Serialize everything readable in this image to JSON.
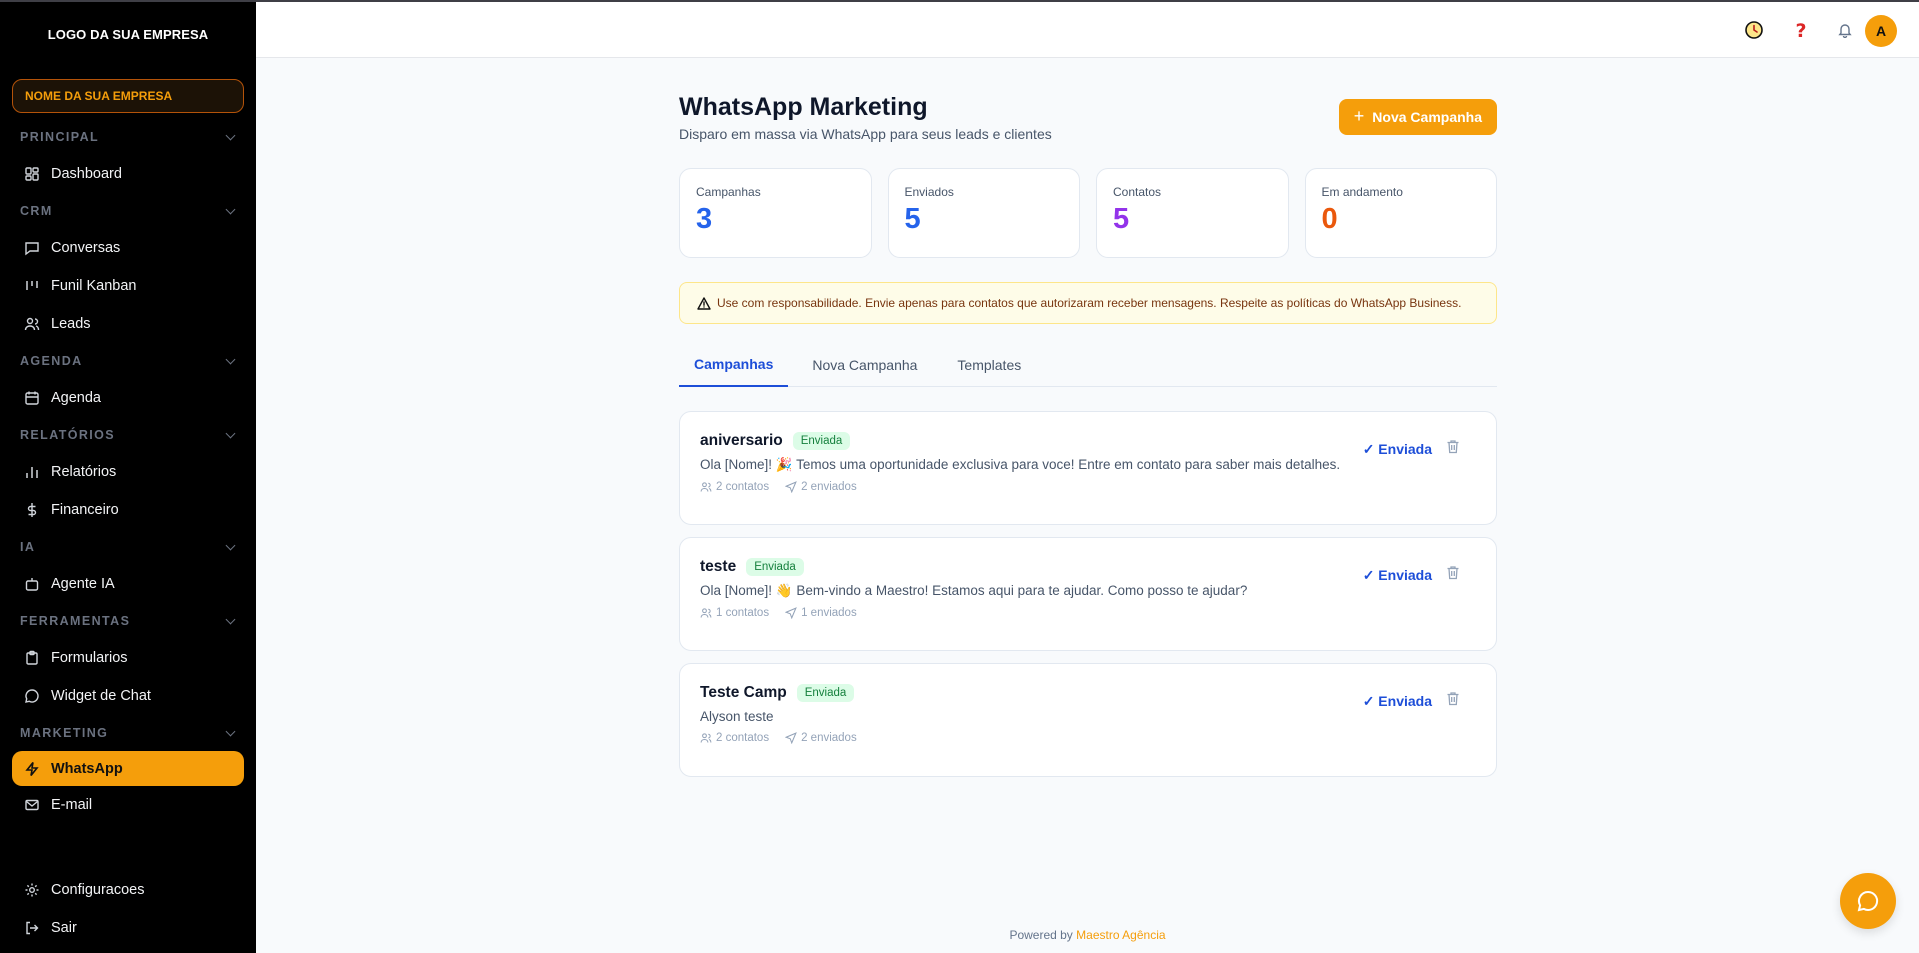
{
  "sidebar": {
    "logo": "LOGO DA SUA EMPRESA",
    "company": "NOME DA SUA EMPRESA",
    "sections": {
      "principal": "PRINCIPAL",
      "crm": "CRM",
      "agenda": "AGENDA",
      "relatorios": "RELATÓRIOS",
      "ia": "IA",
      "ferramentas": "FERRAMENTAS",
      "marketing": "MARKETING"
    },
    "items": {
      "dashboard": "Dashboard",
      "conversas": "Conversas",
      "funil": "Funil Kanban",
      "leads": "Leads",
      "agenda": "Agenda",
      "relatorios": "Relatórios",
      "financeiro": "Financeiro",
      "agente": "Agente IA",
      "formularios": "Formularios",
      "widget": "Widget de Chat",
      "whatsapp": "WhatsApp",
      "email": "E-mail",
      "config": "Configuracoes",
      "sair": "Sair"
    }
  },
  "header": {
    "avatar_letter": "A"
  },
  "page": {
    "title": "WhatsApp Marketing",
    "subtitle": "Disparo em massa via WhatsApp para seus leads e clientes",
    "new_campaign_button": "Nova Campanha"
  },
  "stats": [
    {
      "label": "Campanhas",
      "value": "3",
      "color": "#2563eb"
    },
    {
      "label": "Enviados",
      "value": "5",
      "color": "#2563eb"
    },
    {
      "label": "Contatos",
      "value": "5",
      "color": "#9333ea"
    },
    {
      "label": "Em andamento",
      "value": "0",
      "color": "#ea580c"
    }
  ],
  "alert": "Use com responsabilidade. Envie apenas para contatos que autorizaram receber mensagens. Respeite as políticas do WhatsApp Business.",
  "tabs": [
    "Campanhas",
    "Nova Campanha",
    "Templates"
  ],
  "campaigns": [
    {
      "name": "aniversario",
      "badge": "Enviada",
      "message": "Ola [Nome]! 🎉 Temos uma oportunidade exclusiva para voce! Entre em contato para saber mais detalhes.",
      "contacts": "2 contatos",
      "sent": "2 enviados",
      "status": "✓ Enviada"
    },
    {
      "name": "teste",
      "badge": "Enviada",
      "message": "Ola [Nome]! 👋 Bem-vindo a Maestro! Estamos aqui para te ajudar. Como posso te ajudar?",
      "contacts": "1 contatos",
      "sent": "1 enviados",
      "status": "✓ Enviada"
    },
    {
      "name": "Teste Camp",
      "badge": "Enviada",
      "message": "Alyson teste",
      "contacts": "2 contatos",
      "sent": "2 enviados",
      "status": "✓ Enviada"
    }
  ],
  "footer": {
    "prefix": "Powered by",
    "brand": "Maestro Agência"
  },
  "colors": {
    "accent": "#f59e0b",
    "link": "#1d4ed8",
    "sidebar": "#000000"
  }
}
